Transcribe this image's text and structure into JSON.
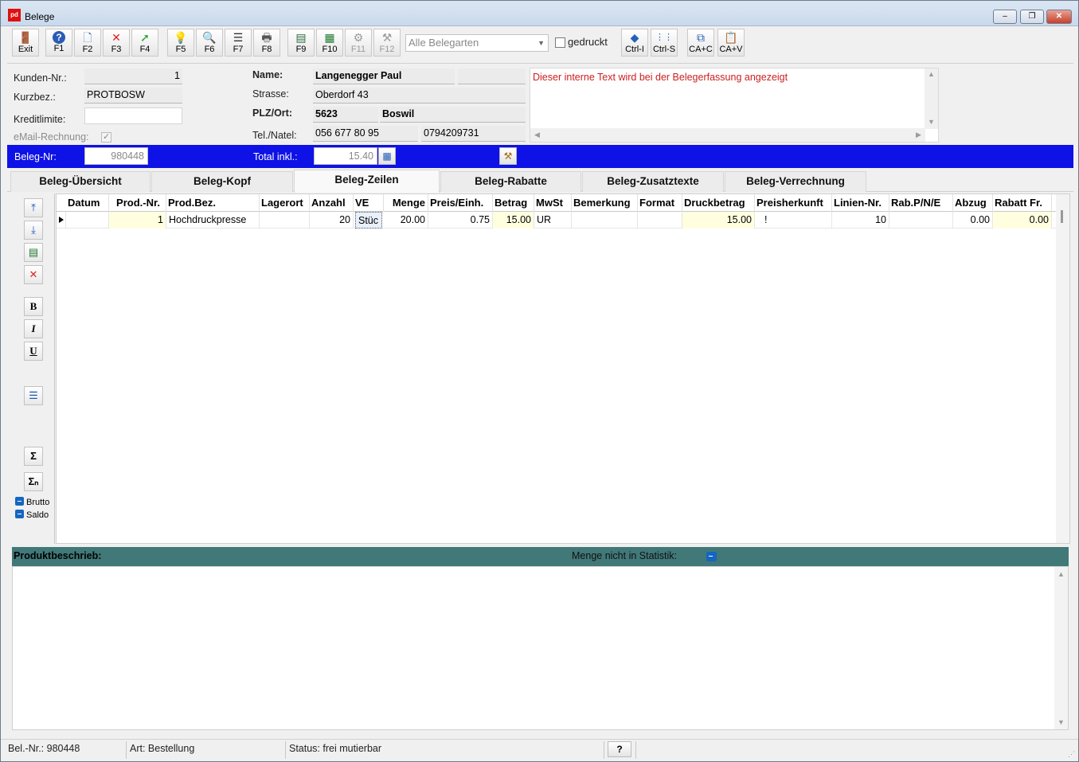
{
  "window": {
    "title": "Belege",
    "app_icon": "pd",
    "controls": {
      "minimize": "–",
      "restore": "❐",
      "close": "✕"
    }
  },
  "toolbar": {
    "buttons": [
      {
        "label": "Exit",
        "icon": "exit-door-icon",
        "glyph": "🚪",
        "enabled": true
      },
      {
        "label": "F1",
        "icon": "help-icon",
        "glyph": "?",
        "enabled": true
      },
      {
        "label": "F2",
        "icon": "new-document-icon",
        "glyph": "🗋",
        "enabled": true
      },
      {
        "label": "F3",
        "icon": "delete-x-icon",
        "glyph": "✕",
        "enabled": true
      },
      {
        "label": "F4",
        "icon": "green-arrow-icon",
        "glyph": "➚",
        "enabled": true
      },
      {
        "label": "F5",
        "icon": "lightbulb-icon",
        "glyph": "💡",
        "enabled": true
      },
      {
        "label": "F6",
        "icon": "magnifier-icon",
        "glyph": "🔍",
        "enabled": true
      },
      {
        "label": "F7",
        "icon": "list-icon",
        "glyph": "☰",
        "enabled": true
      },
      {
        "label": "F8",
        "icon": "printer-icon",
        "glyph": "🖶",
        "enabled": true
      },
      {
        "label": "F9",
        "icon": "export-sheet-icon",
        "glyph": "▤",
        "enabled": true
      },
      {
        "label": "F10",
        "icon": "grid-sheet-icon",
        "glyph": "▦",
        "enabled": true
      },
      {
        "label": "F11",
        "icon": "gear-arrow-icon",
        "glyph": "⚙",
        "enabled": false
      },
      {
        "label": "F12",
        "icon": "tools-icon",
        "glyph": "⚒",
        "enabled": false
      },
      {
        "label": "Ctrl-I",
        "icon": "diamond-icon",
        "glyph": "◆",
        "enabled": true
      },
      {
        "label": "Ctrl-S",
        "icon": "columns-icon",
        "glyph": "⋮⋮",
        "enabled": true
      },
      {
        "label": "CA+C",
        "icon": "copy-icon",
        "glyph": "⧉",
        "enabled": true
      },
      {
        "label": "CA+V",
        "icon": "paste-icon",
        "glyph": "📋",
        "enabled": true
      }
    ],
    "belegarten_select": "Alle Belegarten",
    "gedruckt_label": "gedruckt"
  },
  "customer": {
    "kunden_nr_label": "Kunden-Nr.:",
    "kunden_nr": "1",
    "kurzbez_label": "Kurzbez.:",
    "kurzbez": "PROTBOSW",
    "kreditlimite_label": "Kreditlimite:",
    "kreditlimite": "",
    "email_rechnung_label": "eMail-Rechnung:",
    "name_label": "Name:",
    "name": "Langenegger Paul",
    "strasse_label": "Strasse:",
    "strasse": "Oberdorf 43",
    "plz_ort_label": "PLZ/Ort:",
    "plz": "5623",
    "ort": "Boswil",
    "tel_label": "Tel./Natel:",
    "tel": "056 677 80 95",
    "natel": "0794209731",
    "internal_text": "Dieser interne Text wird bei der Belegerfassung angezeigt"
  },
  "beleg_bar": {
    "beleg_nr_label": "Beleg-Nr:",
    "beleg_nr": "980448",
    "total_label": "Total inkl.:",
    "total": "15.40"
  },
  "tabs": [
    {
      "label": "Beleg-Übersicht",
      "active": false
    },
    {
      "label": "Beleg-Kopf",
      "active": false
    },
    {
      "label": "Beleg-Zeilen",
      "active": true
    },
    {
      "label": "Beleg-Rabatte",
      "active": false
    },
    {
      "label": "Beleg-Zusatztexte",
      "active": false
    },
    {
      "label": "Beleg-Verrechnung",
      "active": false
    }
  ],
  "sidebar": {
    "buttons": [
      "move-up-icon",
      "move-down-icon",
      "insert-row-icon",
      "delete-row-icon",
      "bold-icon",
      "italic-icon",
      "underline-icon",
      "indent-icon",
      "sum-icon",
      "subtotal-icon"
    ],
    "brutto_label": "Brutto",
    "saldo_label": "Saldo"
  },
  "grid": {
    "columns": [
      "Datum",
      "Prod.-Nr.",
      "Prod.Bez.",
      "Lagerort",
      "Anzahl",
      "VE",
      "Menge",
      "Preis/Einh.",
      "Betrag",
      "MwSt",
      "Bemerkung",
      "Format",
      "Druckbetrag",
      "Preisherkunft",
      "Linien-Nr.",
      "Rab.P/N/E",
      "Abzug",
      "Rabatt Fr."
    ],
    "rows": [
      [
        "",
        "1",
        "Hochdruckpresse",
        "",
        "20",
        "Stüc",
        "20.00",
        "0.75",
        "15.00",
        "UR",
        "",
        "",
        "15.00",
        "!",
        "10",
        "",
        "0.00",
        "0.00"
      ]
    ]
  },
  "description": {
    "label": "Produktbeschrieb:",
    "menge_label": "Menge nicht in Statistik:",
    "text": ""
  },
  "status": {
    "bel_nr": "Bel.-Nr.: 980448",
    "art": "Art: Bestellung",
    "status": "Status: frei mutierbar",
    "help": "?"
  },
  "colors": {
    "beleg_bar": "#0e12e6",
    "desc_bar": "#417878",
    "internal_text": "#cc2020",
    "highlight_cell": "#ffffe0"
  }
}
